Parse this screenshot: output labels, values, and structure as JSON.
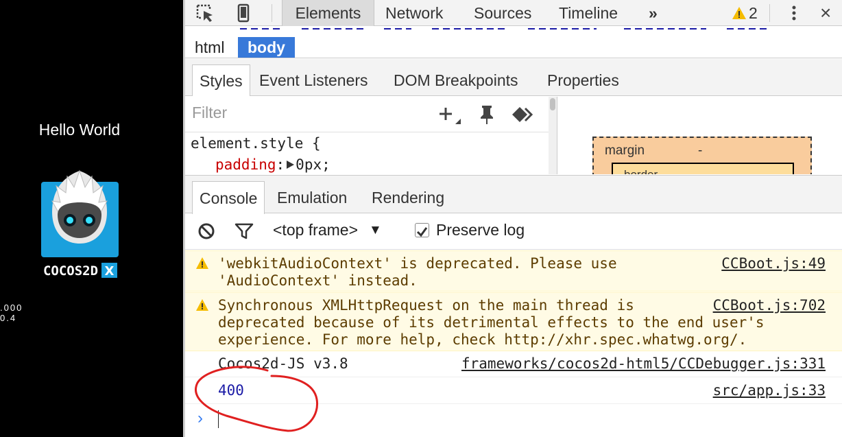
{
  "game": {
    "hello_text": "Hello World",
    "logo_text": "COCOS2D",
    "logo_badge": "X",
    "stats": [
      ".000",
      "0.4"
    ],
    "colors": {
      "background": "#000000",
      "logo_blue": "#1aa0dd",
      "text": "#ffffff"
    }
  },
  "devtools": {
    "toolbar": {
      "inspect_icon": "inspect-arrow-icon",
      "device_icon": "mobile-device-icon",
      "tabs": [
        "Elements",
        "Network",
        "Sources",
        "Timeline"
      ],
      "more_label": "»",
      "warning_count": "2",
      "menu_icon": "vertical-dots-icon",
      "close_label": "×"
    },
    "breadcrumbs": [
      "html",
      "body"
    ],
    "sidebar_tabs": [
      "Styles",
      "Event Listeners",
      "DOM Breakpoints",
      "Properties"
    ],
    "styles": {
      "filter_placeholder": "Filter",
      "add_rule_label": "+",
      "selector": "element.style {",
      "property_name": "padding",
      "property_sep": ":",
      "property_value": "0px;"
    },
    "box_model": {
      "margin_label": "margin",
      "margin_value": "-",
      "border_label": "border"
    },
    "drawer_tabs": [
      "Console",
      "Emulation",
      "Rendering"
    ],
    "console": {
      "frame_selector": "<top frame>",
      "preserve_log_label": "Preserve log",
      "preserve_log_checked": true,
      "messages": [
        {
          "level": "warning",
          "text": "'webkitAudioContext' is deprecated. Please use\n'AudioContext' instead.",
          "source": "CCBoot.js:49"
        },
        {
          "level": "warning",
          "text": "Synchronous XMLHttpRequest on the main thread is\ndeprecated because of its detrimental effects to the end user's\nexperience. For more help, check http://xhr.spec.whatwg.org/.",
          "source": "CCBoot.js:702"
        },
        {
          "level": "log",
          "text": "Cocos2d-JS v3.8",
          "source": "frameworks/cocos2d-html5/CCDebugger.js:331"
        },
        {
          "level": "number",
          "text": "400",
          "source": "src/app.js:33"
        }
      ],
      "prompt_symbol": "›"
    },
    "colors": {
      "accent": "#3879d9",
      "warning_bg": "#fffbe5",
      "warning_icon": "#f5bc00",
      "number_text": "#1a1aa6",
      "property_name": "#c80000",
      "prompt": "#367cf1",
      "annotation": "#e02020"
    }
  }
}
